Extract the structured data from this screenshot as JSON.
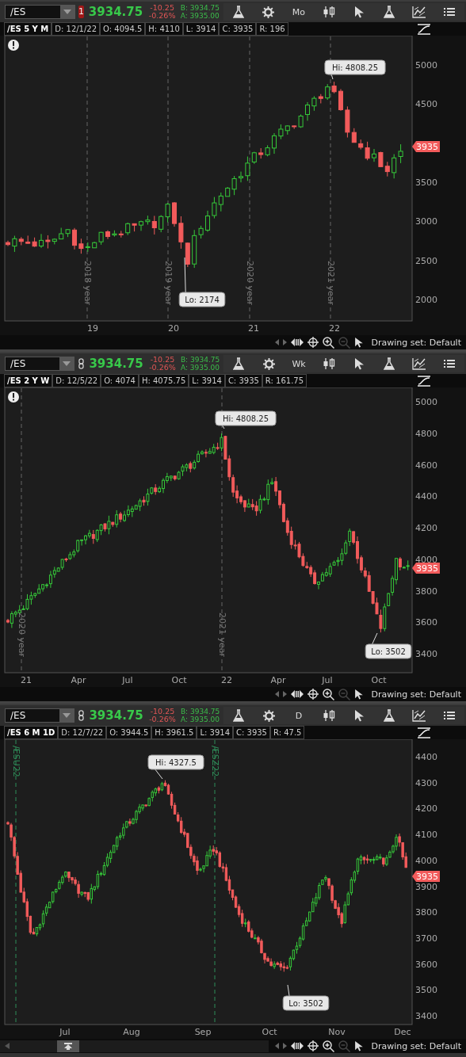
{
  "panels": [
    {
      "toolbar": {
        "symbol": "/ES",
        "link": {
          "kind": "badge",
          "text": "1"
        },
        "last": "3934.75",
        "change": "-10.25",
        "change_pct": "-0.26%",
        "bid": "B: 3934.75",
        "ask": "A: 3935.00",
        "aggregation": "Mo"
      },
      "info": {
        "title": "/ES 5 Y M",
        "fields": [
          "D: 12/1/22",
          "O: 4094.5",
          "H: 4110",
          "L: 3914",
          "C: 3935",
          "R: 196"
        ]
      },
      "alert": true,
      "price_labels": [
        "5000",
        "4500",
        "3500",
        "3000",
        "2500",
        "2000"
      ],
      "price_tag": "3935",
      "time_labels": [
        "19",
        "20",
        "21",
        "22"
      ],
      "markers": [
        {
          "kind": "year",
          "text": "2018 year"
        },
        {
          "kind": "year",
          "text": "2019 year"
        },
        {
          "kind": "year",
          "text": "2020 year"
        },
        {
          "kind": "year",
          "text": "2021 year"
        }
      ],
      "callouts": [
        {
          "kind": "hi",
          "text": "Hi: 4808.25"
        },
        {
          "kind": "lo",
          "text": "Lo: 2174"
        }
      ],
      "footer": {
        "drawing_set": "Drawing set: Default",
        "scrollbar": false
      }
    },
    {
      "toolbar": {
        "symbol": "/ES",
        "link": {
          "kind": "chain"
        },
        "last": "3934.75",
        "change": "-10.25",
        "change_pct": "-0.26%",
        "bid": "B: 3934.75",
        "ask": "A: 3935.00",
        "aggregation": "Wk"
      },
      "info": {
        "title": "/ES 2 Y W",
        "fields": [
          "D: 12/5/22",
          "O: 4074",
          "H: 4075.75",
          "L: 3914",
          "C: 3935",
          "R: 161.75"
        ]
      },
      "alert": true,
      "price_labels": [
        "5000",
        "4800",
        "4600",
        "4400",
        "4200",
        "4000",
        "3800",
        "3600",
        "3400"
      ],
      "price_tag": "3935",
      "time_labels": [
        "21",
        "Apr",
        "Jul",
        "Oct",
        "22",
        "Apr",
        "Jul",
        "Oct"
      ],
      "markers": [
        {
          "kind": "year",
          "text": "2020 year"
        },
        {
          "kind": "year",
          "text": "2021 year"
        }
      ],
      "callouts": [
        {
          "kind": "hi",
          "text": "Hi: 4808.25"
        },
        {
          "kind": "lo",
          "text": "Lo: 3502"
        }
      ],
      "footer": {
        "drawing_set": "Drawing set: Default",
        "scrollbar": false
      }
    },
    {
      "toolbar": {
        "symbol": "/ES",
        "link": {
          "kind": "chain"
        },
        "last": "3934.75",
        "change": "-10.25",
        "change_pct": "-0.26%",
        "bid": "B: 3934.75",
        "ask": "A: 3935.00",
        "aggregation": "D"
      },
      "info": {
        "title": "/ES 6 M 1D",
        "fields": [
          "D: 12/7/22",
          "O: 3944.5",
          "H: 3961.5",
          "L: 3914",
          "C: 3935",
          "R: 47.5"
        ]
      },
      "alert": false,
      "price_labels": [
        "4400",
        "4300",
        "4200",
        "4100",
        "4000",
        "3900",
        "3800",
        "3700",
        "3600",
        "3500",
        "3400"
      ],
      "price_tag": "3935",
      "time_labels": [
        "Jul",
        "Aug",
        "Sep",
        "Oct",
        "Nov",
        "Dec"
      ],
      "markers": [
        {
          "kind": "contract",
          "text": "/ESU22"
        },
        {
          "kind": "contract",
          "text": "/ESZ22"
        }
      ],
      "callouts": [
        {
          "kind": "hi",
          "text": "Hi: 4327.5"
        },
        {
          "kind": "lo",
          "text": "Lo: 3502"
        }
      ],
      "footer": {
        "drawing_set": "Drawing set: Default",
        "scrollbar": true
      }
    }
  ]
}
